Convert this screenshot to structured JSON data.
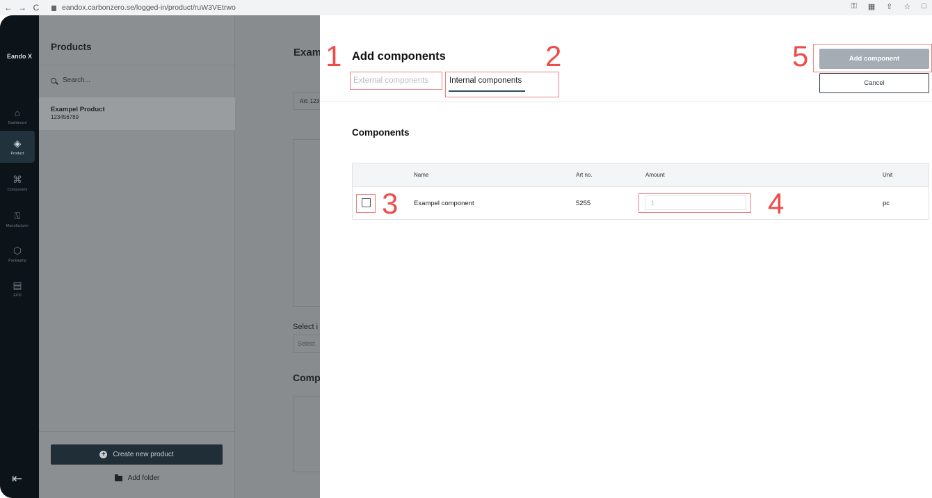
{
  "browser": {
    "back": "←",
    "forward": "→",
    "reload": "C",
    "url": "eandox.carbonzero.se/logged-in/product/ruW3VEtrwo",
    "right_icons": [
      "⚿",
      "▦",
      "⇧",
      "☆",
      "□"
    ]
  },
  "sidebar": {
    "brand": "Eando X",
    "items": [
      {
        "label": "Dashboard",
        "icon": "⌂"
      },
      {
        "label": "Product",
        "icon": "◈"
      },
      {
        "label": "Component",
        "icon": "⌘"
      },
      {
        "label": "Manufacturer",
        "icon": "⍂"
      },
      {
        "label": "Packaging",
        "icon": "⬡"
      },
      {
        "label": "EPD",
        "icon": "▤"
      }
    ],
    "logout_icon": "⇤"
  },
  "products_panel": {
    "title": "Products",
    "search_placeholder": "Search...",
    "product": {
      "name": "Exampel Product",
      "number": "123456789"
    },
    "create_button": "Create new product",
    "add_folder": "Add folder"
  },
  "detail": {
    "title": "Exam",
    "art": "Art: 123",
    "select_label": "Select i",
    "select_placeholder": "Select",
    "components_label": "Comp"
  },
  "modal": {
    "title": "Add components",
    "tabs": {
      "external": "External components",
      "internal": "Internal components"
    },
    "add_button": "Add component",
    "cancel_button": "Cancel",
    "section_title": "Components",
    "table": {
      "headers": {
        "name": "Name",
        "art_no": "Art no.",
        "amount": "Amount",
        "unit": "Unit"
      },
      "row": {
        "name": "Exampel component",
        "art_no": "5255",
        "amount": "1",
        "unit": "pc"
      }
    }
  },
  "annotations": [
    "1",
    "2",
    "3",
    "4",
    "5"
  ],
  "colors": {
    "annotation": "#ef4b4b",
    "primary_dark": "#1f2e37",
    "disabled_button": "#a4adb3"
  }
}
